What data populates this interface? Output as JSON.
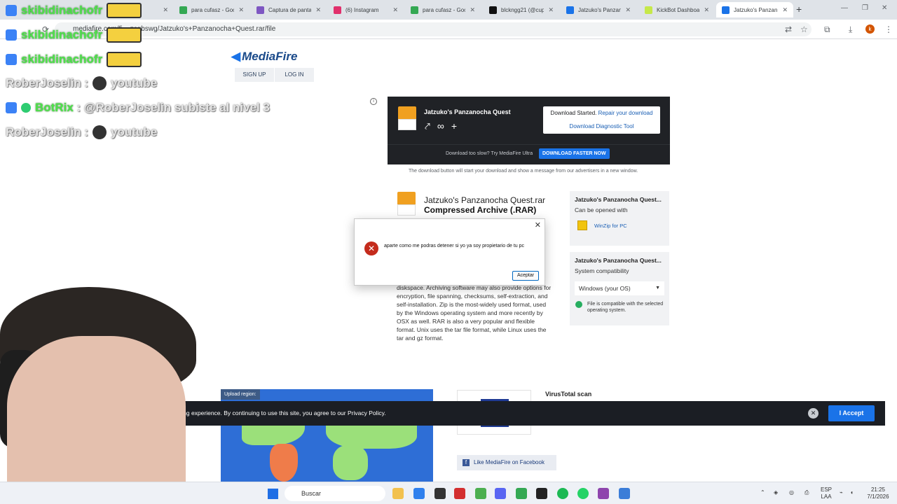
{
  "browser": {
    "tabs": [
      {
        "title": "Kick",
        "color": "#53fc18"
      },
      {
        "title": "para cufasz - Goo",
        "color": "#34a853"
      },
      {
        "title": "Captura de panta",
        "color": "#7e57c2"
      },
      {
        "title": "(6) Instagram",
        "color": "#e1306c"
      },
      {
        "title": "para cufasz - Goo",
        "color": "#34a853"
      },
      {
        "title": "blckngg21 (@cup",
        "color": "#111111"
      },
      {
        "title": "Jatzuko's Panzan",
        "color": "#1a73e8"
      },
      {
        "title": "KickBot Dashboa",
        "color": "#c6e84a"
      },
      {
        "title": "Jatzuko's Panzan",
        "color": "#1a73e8"
      }
    ],
    "url": "mediafire.com/fi... zcgbswg/Jatzuko's+Panzanocha+Quest.rar/file",
    "profile_initial": "k"
  },
  "page": {
    "logo": "MediaFire",
    "signup": "SIGN UP",
    "login": "LOG IN",
    "download_box": {
      "file_title": "Jatzuko's Panzanocha Quest",
      "started_text": "Download Started.",
      "repair_link": "Repair your download",
      "diagnostic_link": "Download Diagnostic Tool",
      "too_slow": "Download too slow? Try MediaFire Ultra",
      "faster_button": "DOWNLOAD FASTER NOW",
      "ads_note": "The download button will start your download and show a message from our advertisers in a new window."
    },
    "file": {
      "name": "Jatzuko's Panzanocha Quest.rar",
      "type": "Compressed Archive (.RAR)",
      "description": "diskspace. Archiving software may also provide options for encryption, file spanning, checksums, self-extraction, and self-installation. Zip is the most-widely used format, used by the Windows operating system and more recently by OSX as well. RAR is also a very popular and flexible format. Unix uses the tar file format, while Linux uses the tar and gz format."
    },
    "side_open": {
      "title": "Jatzuko's Panzanocha Quest...",
      "subtitle": "Can be opened with",
      "app": "WinZip for PC"
    },
    "side_compat": {
      "title": "Jatzuko's Panzanocha Quest...",
      "subtitle": "System compatibility",
      "os_value": "Windows (your OS)",
      "status": "File is compatible with the selected operating system."
    },
    "upload_region": "Upload region:",
    "virustotal": "VirusTotal scan",
    "facebook": "Like MediaFire on Facebook",
    "cookie_text": "sing experience. By continuing to use this site, you agree to our Privacy Policy.",
    "cookie_accept": "I Accept"
  },
  "dialog": {
    "message": "aparte como me podras detener si yo ya soy propietario de tu pc",
    "ok_label": "Aceptar"
  },
  "chat": [
    {
      "user": "skibidinachofr",
      "text": "",
      "emote": true,
      "user_color": "green"
    },
    {
      "user": "skibidinachofr",
      "text": "",
      "emote": true,
      "user_color": "green"
    },
    {
      "user": "skibidinachofr",
      "text": "",
      "emote": true,
      "user_color": "green"
    },
    {
      "user": "RoberJoselin",
      "text": "youtube",
      "emote": false,
      "user_color": "white"
    },
    {
      "user": "BotRix",
      "text": "@RoberJoselin subiste al nivel 3",
      "emote": false,
      "user_color": "green"
    },
    {
      "user": "RoberJoselin",
      "text": "youtube",
      "emote": false,
      "user_color": "white"
    }
  ],
  "taskbar": {
    "search": "Buscar",
    "lang_top": "ESP",
    "lang_bottom": "LAA",
    "time": "21:25",
    "date": "7/1/2026"
  }
}
